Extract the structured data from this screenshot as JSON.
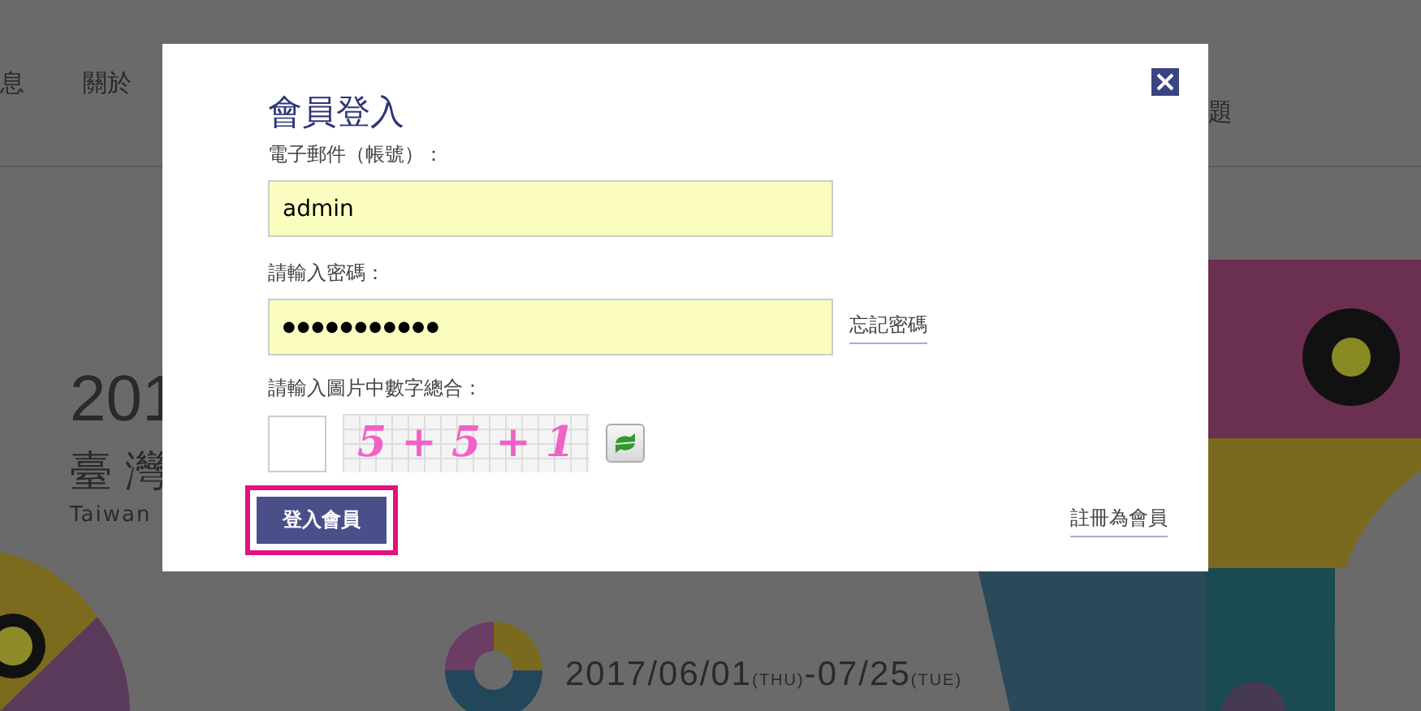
{
  "background_page": {
    "nav_items": [
      "息",
      "關於"
    ],
    "nav_item_right": "題",
    "hero_year": "201",
    "hero_title": "臺灣",
    "hero_subtitle": "Taiwan",
    "date_range": {
      "start": "2017/06/01",
      "start_day": "(THU)",
      "separator": "-",
      "end": "07/25",
      "end_day": "(TUE)"
    }
  },
  "login_dialog": {
    "title": "會員登入",
    "email_label": "電子郵件（帳號）：",
    "email_value": "admin",
    "password_label": "請輸入密碼：",
    "password_value": "●●●●●●●●●●●",
    "forgot_link": "忘記密碼",
    "captcha_label": "請輸入圖片中數字總合：",
    "captcha_text": "5 + 5 + 1",
    "submit_button": {
      "label": "登入會員",
      "highlighted": true
    },
    "register_link": "註冊為會員"
  }
}
